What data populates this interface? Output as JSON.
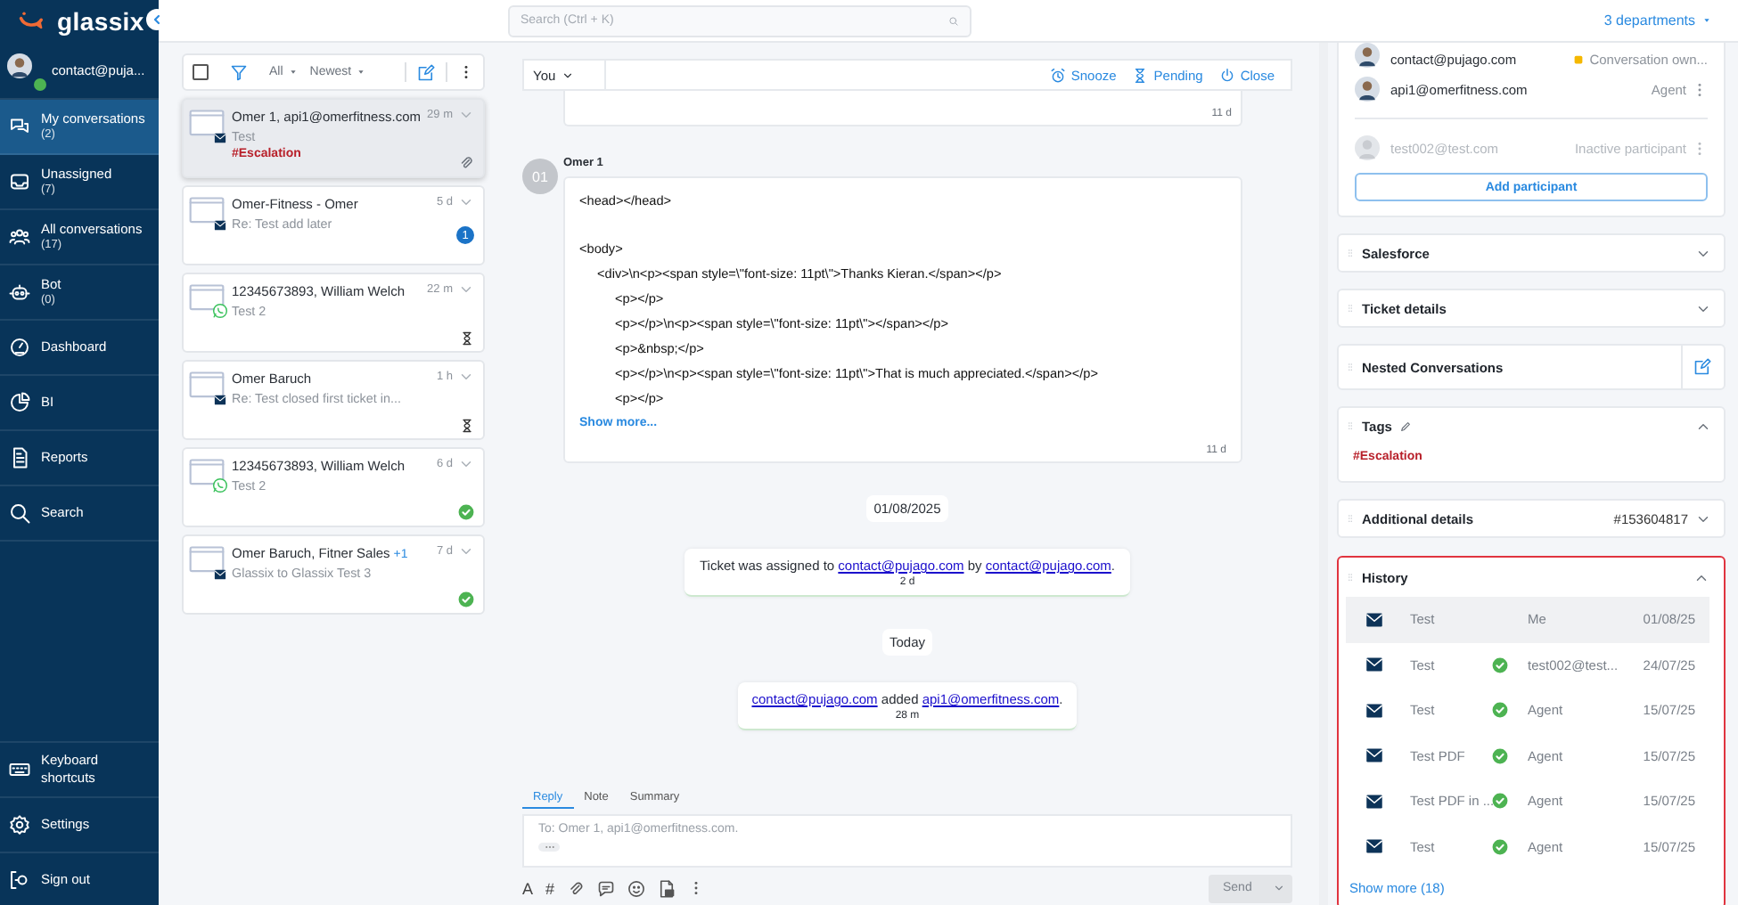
{
  "sidebar": {
    "logo": "glassix",
    "user": {
      "email": "contact@puja...",
      "online": true
    },
    "items": [
      {
        "label": "My conversations",
        "count": "(2)",
        "selected": true
      },
      {
        "label": "Unassigned",
        "count": "(7)",
        "selected": false
      },
      {
        "label": "All conversations",
        "count": "(17)",
        "selected": false
      },
      {
        "label": "Bot",
        "count": "(0)",
        "selected": false
      },
      {
        "label": "Dashboard",
        "selected": false
      },
      {
        "label": "BI",
        "selected": false
      },
      {
        "label": "Reports",
        "selected": false
      },
      {
        "label": "Search",
        "selected": false
      }
    ],
    "bottom_items": [
      {
        "label": "Keyboard shortcuts"
      },
      {
        "label": "Settings"
      },
      {
        "label": "Sign out"
      }
    ]
  },
  "top_bar": {
    "search": {
      "placeholder": "Search (Ctrl + K)"
    },
    "departments": "3 departments"
  },
  "conversation_list": {
    "toolbar": {
      "select_all_checked": false,
      "filter": "All",
      "sort": "Newest"
    },
    "conversations": [
      {
        "title": "Omer 1, api1@omerfitness.com",
        "time": "29 m",
        "channel": {
          "kind": "email"
        },
        "subject": "Test",
        "tag": "#Escalation",
        "status": {
          "kind": "attachment"
        },
        "selected": true
      },
      {
        "title": "Omer-Fitness - Omer",
        "time": "5 d",
        "channel": {
          "kind": "email"
        },
        "subject": "Re: Test add later",
        "status": {
          "kind": "unread",
          "count": "1"
        },
        "selected": false
      },
      {
        "title": "12345673893, William Welch",
        "time": "22 m",
        "channel": {
          "kind": "whatsapp"
        },
        "subject": "Test 2",
        "status": {
          "kind": "pending"
        },
        "selected": false
      },
      {
        "title": "Omer Baruch",
        "time": "1 h",
        "channel": {
          "kind": "email"
        },
        "subject": "Re: Test closed first ticket in...",
        "status": {
          "kind": "pending"
        },
        "selected": false
      },
      {
        "title": "12345673893, William Welch",
        "time": "6 d",
        "channel": {
          "kind": "whatsapp"
        },
        "subject": "Test 2",
        "status": {
          "kind": "done"
        },
        "selected": false
      },
      {
        "title": "Omer Baruch, Fitner Sales",
        "extra": "+1",
        "time": "7 d",
        "channel": {
          "kind": "email"
        },
        "subject": "Glassix to Glassix Test 3",
        "status": {
          "kind": "done"
        },
        "selected": false
      }
    ]
  },
  "conversation": {
    "assignee": "You",
    "actions": [
      "Snooze",
      "Pending",
      "Close"
    ],
    "earlier_message": {
      "time": "11 d"
    },
    "message": {
      "author": "Omer 1",
      "initials": "01",
      "lines": [
        {
          "text": "<head></head>"
        },
        {
          "text": "<body>",
          "children": [
            {
              "text": "<div>\\n<p><span style=\\\"font-size: 11pt\\\">Thanks Kieran.</span></p>",
              "children": [
                {
                  "text": "<p></p>"
                },
                {
                  "text": "<p></p>\\n<p><span style=\\\"font-size: 11pt\\\"></span></p>"
                },
                {
                  "text": "<p>&nbsp;</p>"
                },
                {
                  "text": "<p></p>\\n<p><span style=\\\"font-size: 11pt\\\">That is much appreciated.</span></p>"
                },
                {
                  "text": "<p></p>"
                }
              ]
            }
          ]
        }
      ],
      "show_more": "Show more...",
      "time": "11 d"
    },
    "timeline": [
      {
        "kind": "date",
        "text": "01/08/2025"
      },
      {
        "kind": "event",
        "parts": [
          {
            "kind": "text",
            "text": "Ticket was assigned to "
          },
          {
            "kind": "link",
            "text": "contact@pujago.com"
          },
          {
            "kind": "text",
            "text": " by "
          },
          {
            "kind": "link",
            "text": "contact@pujago.com"
          },
          {
            "kind": "text",
            "text": "."
          }
        ],
        "time": "2 d"
      },
      {
        "kind": "date",
        "text": "Today"
      },
      {
        "kind": "event",
        "parts": [
          {
            "kind": "link",
            "text": "contact@pujago.com"
          },
          {
            "kind": "text",
            "text": " added "
          },
          {
            "kind": "link",
            "text": "api1@omerfitness.com"
          },
          {
            "kind": "text",
            "text": "."
          }
        ],
        "time": "28 m"
      }
    ]
  },
  "composer": {
    "tabs": [
      {
        "label": "Reply",
        "selected": true
      },
      {
        "label": "Note",
        "selected": false
      },
      {
        "label": "Summary",
        "selected": false
      }
    ],
    "placeholder": "To: Omer 1, api1@omerfitness.com.",
    "format_buttons": [
      "A",
      "#"
    ],
    "send": {
      "label": "Send",
      "disabled": true
    }
  },
  "details": {
    "participants": [
      {
        "email": "contact@pujago.com",
        "role": "Conversation own...",
        "kind": "owner",
        "inactive": false
      },
      {
        "email": "api1@omerfitness.com",
        "role": "Agent",
        "kind": "agent",
        "inactive": false
      },
      {
        "email": "test002@test.com",
        "role": "Inactive participant",
        "kind": "agent",
        "inactive": true
      }
    ],
    "add_participant": "Add participant",
    "sections": [
      {
        "kind": "plain",
        "title": "Salesforce",
        "expanded": false
      },
      {
        "kind": "plain",
        "title": "Ticket details",
        "expanded": false
      },
      {
        "kind": "nested",
        "title": "Nested Conversations"
      },
      {
        "kind": "tags",
        "title": "Tags",
        "expanded": true,
        "tags": [
          "#Escalation"
        ]
      },
      {
        "kind": "plain",
        "title": "Additional details",
        "value": "#153604817",
        "expanded": false
      },
      {
        "kind": "history",
        "title": "History",
        "expanded": true,
        "highlighted": true,
        "show_more": "Show more (18)",
        "rows": [
          {
            "subject": "Test",
            "by": "Me",
            "date": "01/08/25",
            "done": false,
            "selected": true
          },
          {
            "subject": "Test",
            "by": "test002@test...",
            "date": "24/07/25",
            "done": true,
            "selected": false
          },
          {
            "subject": "Test",
            "by": "Agent",
            "date": "15/07/25",
            "done": true,
            "selected": false
          },
          {
            "subject": "Test PDF",
            "by": "Agent",
            "date": "15/07/25",
            "done": true,
            "selected": false
          },
          {
            "subject": "Test PDF in ...",
            "by": "Agent",
            "date": "15/07/25",
            "done": true,
            "selected": false
          },
          {
            "subject": "Test",
            "by": "Agent",
            "date": "15/07/25",
            "done": true,
            "selected": false
          }
        ]
      }
    ]
  }
}
